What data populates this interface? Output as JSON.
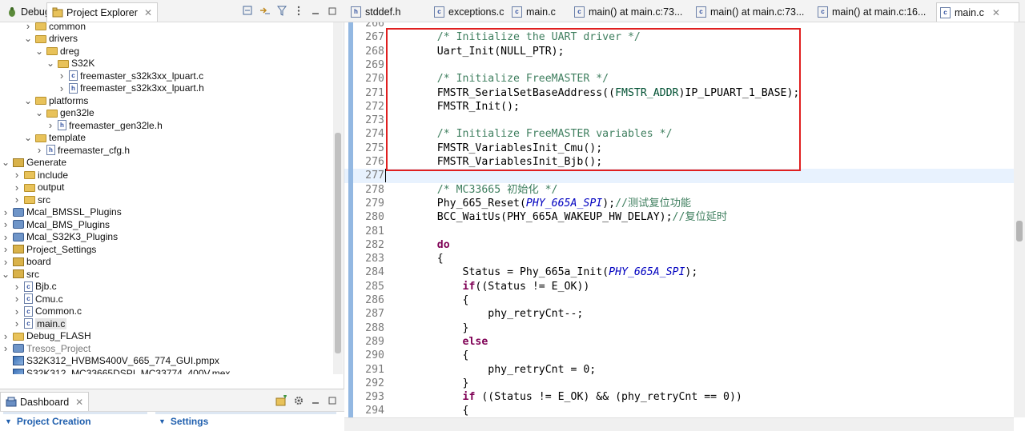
{
  "left_panel": {
    "tab_debug": "Debug",
    "tab_explorer": "Project Explorer",
    "close_glyph": "✕",
    "tree": [
      {
        "label": "common",
        "depth": 3,
        "twisty": "collapsed",
        "icon": "folder"
      },
      {
        "label": "drivers",
        "depth": 3,
        "twisty": "expanded",
        "icon": "folder"
      },
      {
        "label": "dreg",
        "depth": 4,
        "twisty": "expanded",
        "icon": "folder"
      },
      {
        "label": "S32K",
        "depth": 5,
        "twisty": "expanded",
        "icon": "folder"
      },
      {
        "label": "freemaster_s32k3xx_lpuart.c",
        "depth": 6,
        "twisty": "collapsed",
        "icon": "c-file"
      },
      {
        "label": "freemaster_s32k3xx_lpuart.h",
        "depth": 6,
        "twisty": "collapsed",
        "icon": "h-file"
      },
      {
        "label": "platforms",
        "depth": 3,
        "twisty": "expanded",
        "icon": "folder"
      },
      {
        "label": "gen32le",
        "depth": 4,
        "twisty": "expanded",
        "icon": "folder"
      },
      {
        "label": "freemaster_gen32le.h",
        "depth": 5,
        "twisty": "collapsed",
        "icon": "h-file"
      },
      {
        "label": "template",
        "depth": 3,
        "twisty": "expanded",
        "icon": "folder"
      },
      {
        "label": "freemaster_cfg.h",
        "depth": 4,
        "twisty": "collapsed",
        "icon": "h-file"
      },
      {
        "label": "Generate",
        "depth": 1,
        "twisty": "expanded",
        "icon": "gen-folder"
      },
      {
        "label": "include",
        "depth": 2,
        "twisty": "collapsed",
        "icon": "folder"
      },
      {
        "label": "output",
        "depth": 2,
        "twisty": "collapsed",
        "icon": "folder"
      },
      {
        "label": "src",
        "depth": 2,
        "twisty": "collapsed",
        "icon": "folder"
      },
      {
        "label": "Mcal_BMSSL_Plugins",
        "depth": 1,
        "twisty": "collapsed",
        "icon": "project"
      },
      {
        "label": "Mcal_BMS_Plugins",
        "depth": 1,
        "twisty": "collapsed",
        "icon": "project"
      },
      {
        "label": "Mcal_S32K3_Plugins",
        "depth": 1,
        "twisty": "collapsed",
        "icon": "project"
      },
      {
        "label": "Project_Settings",
        "depth": 1,
        "twisty": "collapsed",
        "icon": "gen-folder"
      },
      {
        "label": "board",
        "depth": 1,
        "twisty": "collapsed",
        "icon": "gen-folder"
      },
      {
        "label": "src",
        "depth": 1,
        "twisty": "expanded",
        "icon": "gen-folder"
      },
      {
        "label": "Bjb.c",
        "depth": 2,
        "twisty": "collapsed",
        "icon": "c-file"
      },
      {
        "label": "Cmu.c",
        "depth": 2,
        "twisty": "collapsed",
        "icon": "c-file"
      },
      {
        "label": "Common.c",
        "depth": 2,
        "twisty": "collapsed",
        "icon": "c-file"
      },
      {
        "label": "main.c",
        "depth": 2,
        "twisty": "collapsed",
        "icon": "c-file",
        "selected": true
      },
      {
        "label": "Debug_FLASH",
        "depth": 1,
        "twisty": "collapsed",
        "icon": "folder"
      },
      {
        "label": "Tresos_Project",
        "depth": 1,
        "twisty": "collapsed",
        "icon": "project",
        "dim": true
      },
      {
        "label": "S32K312_HVBMS400V_665_774_GUI.pmpx",
        "depth": 1,
        "twisty": "none",
        "icon": "image-file"
      },
      {
        "label": "S32K312_MC33665DSPI_MC33774_400V.mex",
        "depth": 1,
        "twisty": "none",
        "icon": "image-file"
      }
    ]
  },
  "dashboard": {
    "tab_label": "Dashboard",
    "sections": [
      "Project Creation",
      "Settings"
    ]
  },
  "editor": {
    "tabs": [
      {
        "label": "stddef.h",
        "icon": "h"
      },
      {
        "label": "exceptions.c",
        "icon": "c"
      },
      {
        "label": "main.c",
        "icon": "c"
      },
      {
        "label": "main() at main.c:73...",
        "icon": "c"
      },
      {
        "label": "main() at main.c:73...",
        "icon": "c"
      },
      {
        "label": "main() at main.c:16...",
        "icon": "c"
      },
      {
        "label": "main.c",
        "icon": "c",
        "active": true
      }
    ],
    "current_line": 277,
    "lines": [
      {
        "n": "266",
        "tokens": []
      },
      {
        "n": "267",
        "tokens": [
          [
            "cm",
            "    /* Initialize the UART driver */"
          ]
        ]
      },
      {
        "n": "268",
        "tokens": [
          [
            "",
            "    Uart_Init(NULL_PTR);"
          ]
        ]
      },
      {
        "n": "269",
        "tokens": []
      },
      {
        "n": "270",
        "tokens": [
          [
            "cm",
            "    /* Initialize FreeMASTER */"
          ]
        ]
      },
      {
        "n": "271",
        "tokens": [
          [
            "",
            "    FMSTR_SerialSetBaseAddress(("
          ],
          [
            "ty",
            "FMSTR_ADDR"
          ],
          [
            "",
            ")IP_LPUART_1_BASE);"
          ]
        ]
      },
      {
        "n": "272",
        "tokens": [
          [
            "",
            "    FMSTR_Init();"
          ]
        ]
      },
      {
        "n": "273",
        "tokens": []
      },
      {
        "n": "274",
        "tokens": [
          [
            "cm",
            "    /* Initialize FreeMASTER variables */"
          ]
        ]
      },
      {
        "n": "275",
        "tokens": [
          [
            "",
            "    FMSTR_VariablesInit_Cmu();"
          ]
        ]
      },
      {
        "n": "276",
        "tokens": [
          [
            "",
            "    FMSTR_VariablesInit_Bjb();"
          ]
        ]
      },
      {
        "n": "277",
        "tokens": []
      },
      {
        "n": "278",
        "tokens": [
          [
            "cm",
            "    /* MC33665 初始化 */"
          ]
        ]
      },
      {
        "n": "279",
        "tokens": [
          [
            "",
            "    Phy_665_Reset("
          ],
          [
            "it",
            "PHY_665A_SPI"
          ],
          [
            "",
            ");"
          ],
          [
            "cm",
            "//测试复位功能"
          ]
        ]
      },
      {
        "n": "280",
        "tokens": [
          [
            "",
            "    BCC_WaitUs(PHY_665A_WAKEUP_HW_DELAY);"
          ],
          [
            "cm",
            "//复位延时"
          ]
        ]
      },
      {
        "n": "281",
        "tokens": []
      },
      {
        "n": "282",
        "tokens": [
          [
            "kw",
            "    do"
          ]
        ]
      },
      {
        "n": "283",
        "tokens": [
          [
            "",
            "    {"
          ]
        ]
      },
      {
        "n": "284",
        "tokens": [
          [
            "",
            "        Status = Phy_665a_Init("
          ],
          [
            "it",
            "PHY_665A_SPI"
          ],
          [
            "",
            ");"
          ]
        ]
      },
      {
        "n": "285",
        "tokens": [
          [
            "kw",
            "        if"
          ],
          [
            "",
            "((Status != E_OK))"
          ]
        ]
      },
      {
        "n": "286",
        "tokens": [
          [
            "",
            "        {"
          ]
        ]
      },
      {
        "n": "287",
        "tokens": [
          [
            "",
            "            phy_retryCnt--;"
          ]
        ]
      },
      {
        "n": "288",
        "tokens": [
          [
            "",
            "        }"
          ]
        ]
      },
      {
        "n": "289",
        "tokens": [
          [
            "kw",
            "        else"
          ]
        ]
      },
      {
        "n": "290",
        "tokens": [
          [
            "",
            "        {"
          ]
        ]
      },
      {
        "n": "291",
        "tokens": [
          [
            "",
            "            phy_retryCnt = 0;"
          ]
        ]
      },
      {
        "n": "292",
        "tokens": [
          [
            "",
            "        }"
          ]
        ]
      },
      {
        "n": "293",
        "tokens": [
          [
            "kw",
            "        if"
          ],
          [
            "",
            " ((Status != E_OK) && (phy_retryCnt == 0))"
          ]
        ]
      },
      {
        "n": "294",
        "tokens": [
          [
            "",
            "        {"
          ]
        ]
      }
    ]
  },
  "colors": {
    "highlight_box": "#e02020",
    "comment": "#3f7f5f",
    "keyword": "#7f0055",
    "macro_italic": "#0000c0",
    "current_line_bg": "#e8f2fe",
    "section_header": "#1f5fae"
  }
}
